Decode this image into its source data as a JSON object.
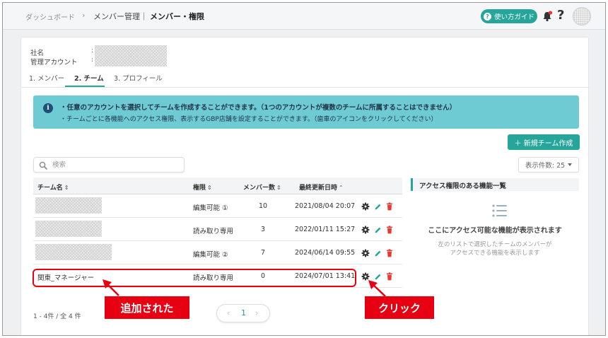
{
  "breadcrumb": {
    "dashboard": "ダッシュボード",
    "separator": "›",
    "member_mgmt": "メンバー管理｜",
    "current": "メンバー・権限"
  },
  "header": {
    "guide_label": "使い方ガイド",
    "help_label": "?"
  },
  "account": {
    "company_label": "社名",
    "admin_label": "管理アカウント",
    "colon": ":"
  },
  "tabs": [
    {
      "label": "1. メンバー"
    },
    {
      "label": "2. チーム"
    },
    {
      "label": "3. プロフィール"
    }
  ],
  "info": {
    "line1": "・任意のアカウントを選択してチームを作成することができます。（1つのアカウントが複数のチームに所属することはできません）",
    "line2": "・チームごとに各機能へのアクセス権限、表示するGBP店舗を設定することができます。（歯車のアイコンをクリックしてください）"
  },
  "toolbar": {
    "new_team_label": "＋ 新規チーム作成",
    "per_page_label": "表示件数: 25"
  },
  "search": {
    "placeholder": "検索",
    "value": ""
  },
  "table": {
    "headers": {
      "name": "チーム名",
      "permission": "権限",
      "members": "メンバー数",
      "updated": "最終更新日時"
    },
    "sort_icon": "⇕",
    "sort_up_icon": "⌃",
    "rows": [
      {
        "name": "",
        "permission": "編集可能 ①",
        "members": "10",
        "updated": "2021/08/04 20:07"
      },
      {
        "name": "",
        "permission": "読み取り専用",
        "members": "3",
        "updated": "2022/01/11 15:27"
      },
      {
        "name": "",
        "permission": "編集可能 ②",
        "members": "7",
        "updated": "2024/06/14 09:55"
      },
      {
        "name": "関東_マネージャー",
        "permission": "読み取り専用",
        "members": "0",
        "updated": "2024/07/01 13:41"
      }
    ]
  },
  "pagination": {
    "summary": "1 - 4件 / 全 4 件",
    "prev": "‹",
    "page": "1",
    "next": "›"
  },
  "panel": {
    "title": "アクセス権限のある機能一覧",
    "empty_title": "ここにアクセス可能な機能が表示されます",
    "empty_line1": "左のリストで選択したチームのメンバーが",
    "empty_line2": "アクセスできる機能を表示します"
  },
  "callouts": {
    "added": "追加された",
    "click": "クリック"
  },
  "colors": {
    "accent": "#26a69a",
    "info_bg": "#6ecbd4",
    "danger": "#e53935",
    "callout": "#e60012"
  }
}
